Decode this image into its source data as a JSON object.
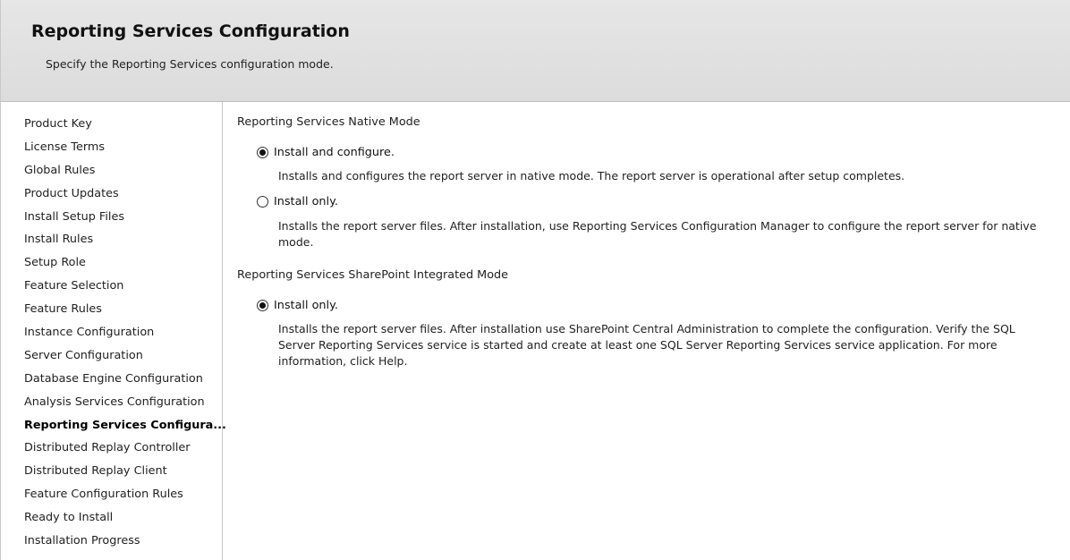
{
  "header": {
    "title": "Reporting Services Configuration",
    "subtitle": "Specify the Reporting Services configuration mode."
  },
  "nav": {
    "items": [
      {
        "label": "Product Key"
      },
      {
        "label": "License Terms"
      },
      {
        "label": "Global Rules"
      },
      {
        "label": "Product Updates"
      },
      {
        "label": "Install Setup Files"
      },
      {
        "label": "Install Rules"
      },
      {
        "label": "Setup Role"
      },
      {
        "label": "Feature Selection"
      },
      {
        "label": "Feature Rules"
      },
      {
        "label": "Instance Configuration"
      },
      {
        "label": "Server Configuration"
      },
      {
        "label": "Database Engine Configuration"
      },
      {
        "label": "Analysis Services Configuration"
      },
      {
        "label": "Reporting Services Configura...",
        "active": true
      },
      {
        "label": "Distributed Replay Controller"
      },
      {
        "label": "Distributed Replay Client"
      },
      {
        "label": "Feature Configuration Rules"
      },
      {
        "label": "Ready to Install"
      },
      {
        "label": "Installation Progress"
      }
    ]
  },
  "native_mode": {
    "title": "Reporting Services Native Mode",
    "options": [
      {
        "label": "Install and configure.",
        "checked": true,
        "description": "Installs and configures the report server in native mode. The report server is operational after setup completes."
      },
      {
        "label": "Install only.",
        "checked": false,
        "description": "Installs the report server files. After installation, use Reporting Services Configuration Manager to configure the report server for native mode."
      }
    ]
  },
  "sharepoint_mode": {
    "title": "Reporting Services SharePoint Integrated Mode",
    "options": [
      {
        "label": "Install only.",
        "checked": true,
        "description": "Installs the report server files.  After installation use SharePoint Central Administration to complete the configuration.  Verify the SQL Server Reporting Services service is started and create at least one SQL Server Reporting Services service application. For more information, click Help."
      }
    ]
  }
}
